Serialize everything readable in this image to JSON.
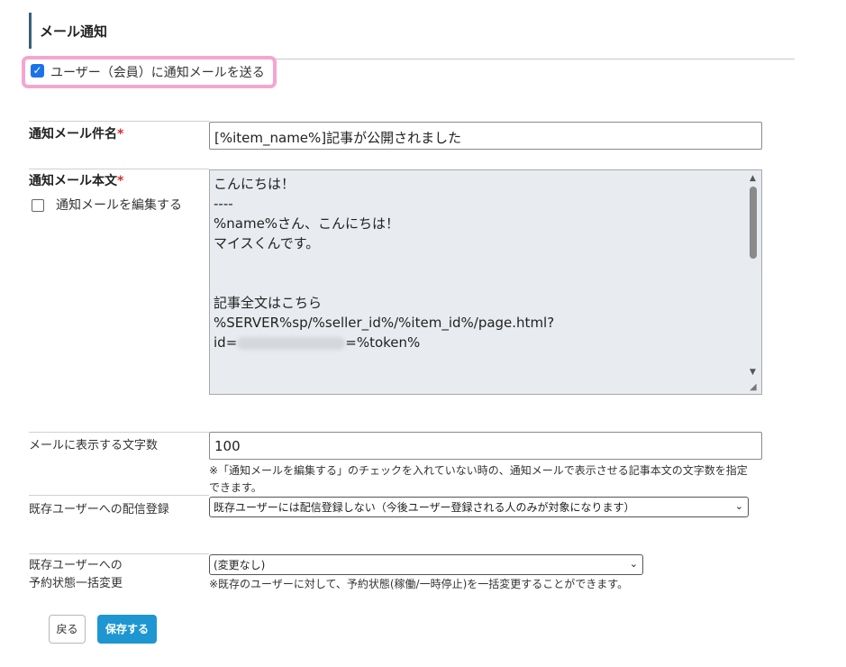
{
  "section": {
    "title": "メール通知"
  },
  "notify_checkbox": {
    "checked": true,
    "label": "ユーザー（会員）に通知メールを送る"
  },
  "subject": {
    "label": "通知メール件名",
    "required_mark": "*",
    "value": "[%item_name%]記事が公開されました"
  },
  "body": {
    "label": "通知メール本文",
    "required_mark": "*",
    "edit_checkbox_label": "通知メールを編集する",
    "edit_checked": false,
    "lines": [
      "こんにちは！",
      "----",
      "%name%さん、こんにちは！",
      "マイスくんです。",
      "",
      "",
      "記事全文はこちら",
      "%SERVER%sp/%seller_id%/%item_id%/page.html?"
    ],
    "last_line_prefix": "id=",
    "last_line_suffix": "=%token%"
  },
  "char_count": {
    "label": "メールに表示する文字数",
    "value": "100",
    "note_line1": "※「通知メールを編集する」のチェックを入れていない時の、通知メールで表示させる記事本文の文字数を指定",
    "note_line2": "できます。"
  },
  "existing_delivery": {
    "label": "既存ユーザーへの配信登録",
    "selected": "既存ユーザーには配信登録しない（今後ユーザー登録される人のみが対象になります）"
  },
  "bulk_change": {
    "label_line1": "既存ユーザーへの",
    "label_line2": "予約状態一括変更",
    "selected": "(変更なし)",
    "note": "※既存のユーザーに対して、予約状態(稼働/一時停止)を一括変更することができます。"
  },
  "buttons": {
    "back": "戻る",
    "save": "保存する"
  },
  "colors": {
    "accent": "#1d96d2",
    "highlight": "#f4a6d0",
    "required": "#d32f2f"
  }
}
